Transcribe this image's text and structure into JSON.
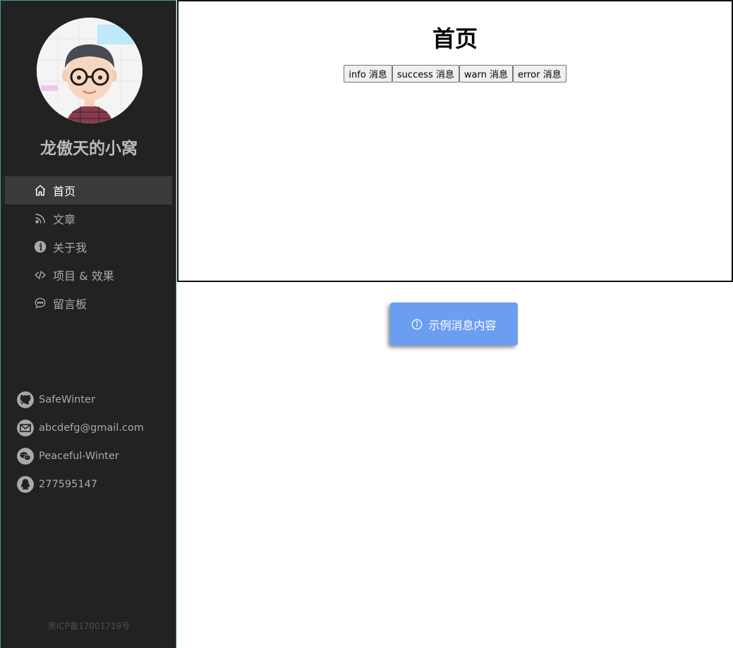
{
  "sidebar": {
    "site_title": "龙傲天的小窝",
    "menu": [
      {
        "label": "首页",
        "icon": "home-icon",
        "active": true
      },
      {
        "label": "文章",
        "icon": "blog-icon",
        "active": false
      },
      {
        "label": "关于我",
        "icon": "info-icon",
        "active": false
      },
      {
        "label": "项目 & 效果",
        "icon": "code-icon",
        "active": false
      },
      {
        "label": "留言板",
        "icon": "chat-icon",
        "active": false
      }
    ],
    "contacts": [
      {
        "label": "SafeWinter",
        "icon": "github-icon"
      },
      {
        "label": "abcdefg@gmail.com",
        "icon": "mail-icon"
      },
      {
        "label": "Peaceful-Winter",
        "icon": "wechat-icon"
      },
      {
        "label": "277595147",
        "icon": "qq-icon"
      }
    ],
    "icp": "黑ICP备17001719号"
  },
  "main": {
    "title": "首页",
    "buttons": [
      {
        "label": "info 消息"
      },
      {
        "label": "success 消息"
      },
      {
        "label": "warn 消息"
      },
      {
        "label": "error 消息"
      }
    ]
  },
  "toast": {
    "text": "示例消息内容",
    "icon": "info-circle-icon",
    "color": "#6b9ef1"
  },
  "colors": {
    "sidebar_bg": "#222222",
    "active_item_bg": "#3a3a3a",
    "muted_text": "#a9a9a9"
  }
}
